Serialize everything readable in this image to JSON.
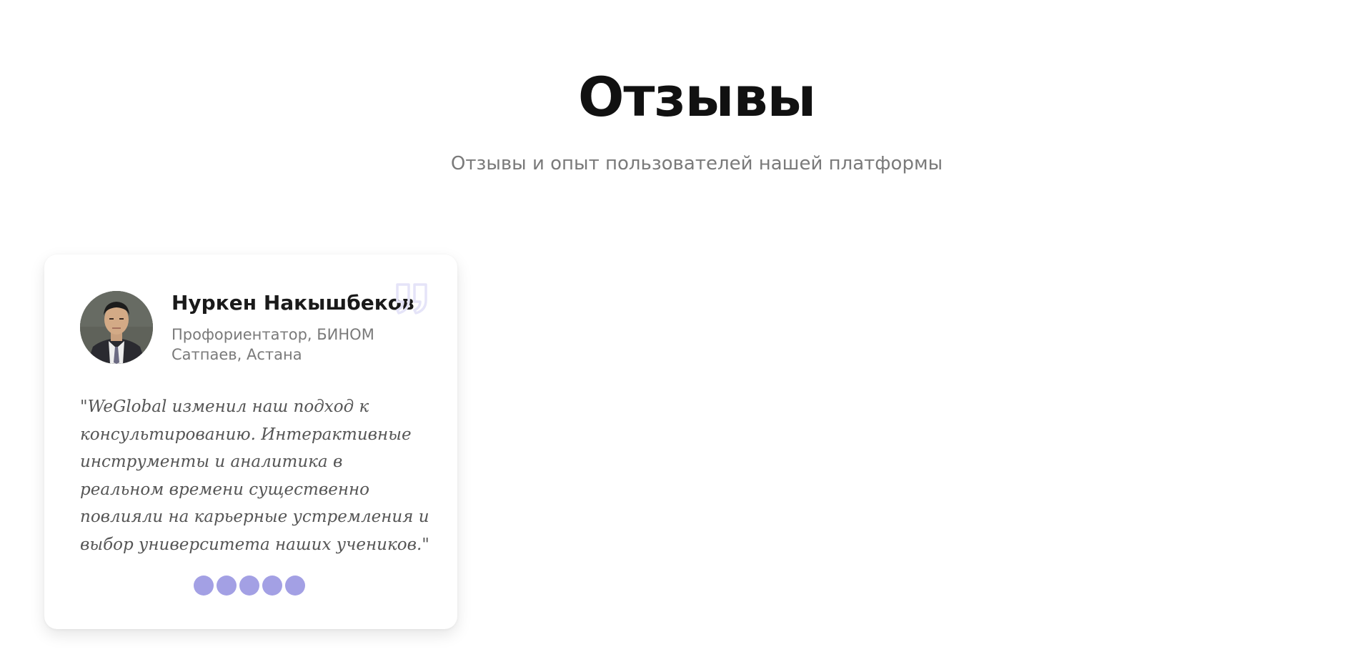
{
  "section": {
    "title": "Отзывы",
    "subtitle": "Отзывы и опыт пользователей нашей платформы"
  },
  "testimonial": {
    "name": "Нуркен Накышбеков",
    "role": "Профориентатор, БИНОМ Сатпаев, Астана",
    "quote": "\"WeGlobal изменил наш подход к консультированию. Интерактивные инструменты и аналитика в реальном времени существенно повлияли на карьерные устремления и выбор университета наших учеников.\"",
    "rating": 5,
    "rating_max": 5,
    "icons": {
      "avatar": "avatar-photo",
      "quote": "quote-icon",
      "star": "rating-dot"
    },
    "colors": {
      "accent": "#a3a0e4",
      "quote_icon": "#e5e4f8"
    }
  }
}
